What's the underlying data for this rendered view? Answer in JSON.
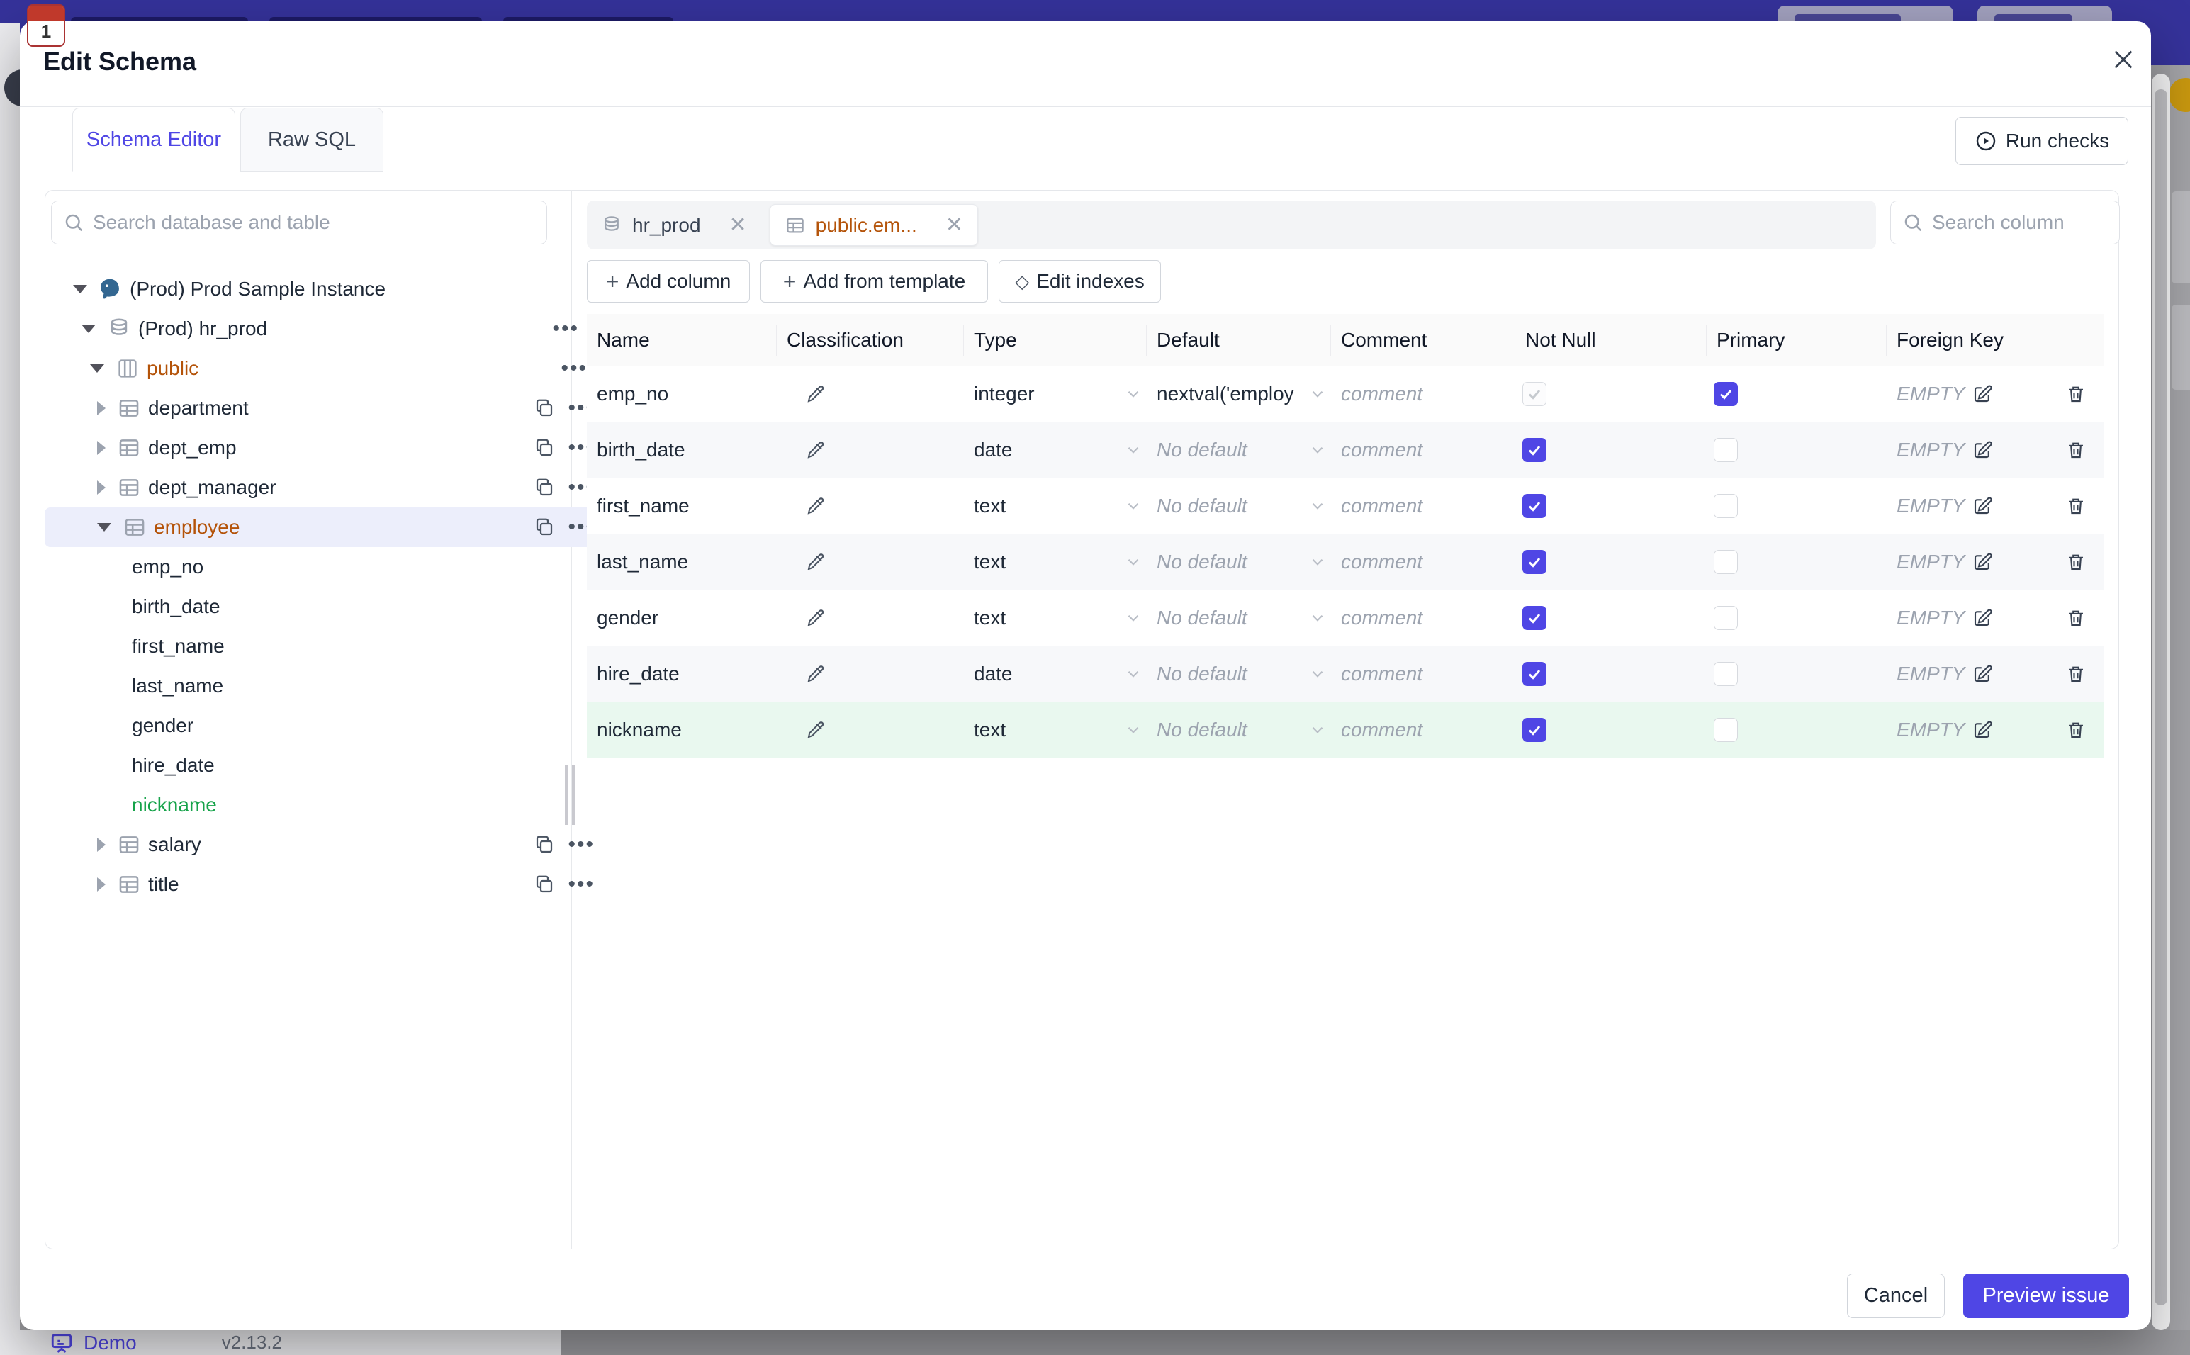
{
  "underlying": {
    "demo_label": "Demo",
    "version": "v2.13.2"
  },
  "modal": {
    "title": "Edit Schema",
    "close_icon": "x",
    "tabs": [
      {
        "label": "Schema Editor",
        "active": true
      },
      {
        "label": "Raw SQL",
        "active": false
      }
    ],
    "run_checks_label": "Run checks",
    "sidebar": {
      "search_placeholder": "Search database and table",
      "tree": [
        {
          "label": "(Prod) Prod Sample Instance",
          "type": "instance",
          "icon": "postgres-icon",
          "expanded": true
        },
        {
          "label": "(Prod) hr_prod",
          "type": "database",
          "icon": "database-icon",
          "expanded": true
        },
        {
          "label": "public",
          "type": "schema",
          "icon": "schema-icon",
          "expanded": true,
          "color": "orange"
        },
        {
          "label": "department",
          "type": "table",
          "icon": "table-icon",
          "expanded": false
        },
        {
          "label": "dept_emp",
          "type": "table",
          "icon": "table-icon",
          "expanded": false
        },
        {
          "label": "dept_manager",
          "type": "table",
          "icon": "table-icon",
          "expanded": false
        },
        {
          "label": "employee",
          "type": "table",
          "icon": "table-icon",
          "expanded": true,
          "selected": true,
          "color": "orange"
        },
        {
          "label": "emp_no",
          "type": "column"
        },
        {
          "label": "birth_date",
          "type": "column"
        },
        {
          "label": "first_name",
          "type": "column"
        },
        {
          "label": "last_name",
          "type": "column"
        },
        {
          "label": "gender",
          "type": "column"
        },
        {
          "label": "hire_date",
          "type": "column"
        },
        {
          "label": "nickname",
          "type": "column",
          "color": "green"
        },
        {
          "label": "salary",
          "type": "table",
          "icon": "table-icon",
          "expanded": false
        },
        {
          "label": "title",
          "type": "table",
          "icon": "table-icon",
          "expanded": false
        }
      ]
    },
    "editor": {
      "chips": [
        {
          "label": "hr_prod",
          "icon": "database-icon",
          "active": false
        },
        {
          "label": "public.em...",
          "icon": "table-icon",
          "active": true
        }
      ],
      "toolbar": {
        "add_column": "Add column",
        "add_from_template": "Add from template",
        "edit_indexes": "Edit indexes"
      },
      "search_placeholder": "Search column",
      "table": {
        "columns": [
          "Name",
          "Classification",
          "Type",
          "Default",
          "Comment",
          "Not Null",
          "Primary",
          "Foreign Key"
        ],
        "comment_placeholder": "comment",
        "rows": [
          {
            "name": "emp_no",
            "type": "integer",
            "default": "nextval('employ",
            "default_is_placeholder": false,
            "comment": "comment",
            "not_null": true,
            "not_null_disabled": true,
            "primary": true,
            "foreign_key": "EMPTY"
          },
          {
            "name": "birth_date",
            "type": "date",
            "default": "No default",
            "default_is_placeholder": true,
            "comment": "comment",
            "not_null": true,
            "not_null_disabled": false,
            "primary": false,
            "foreign_key": "EMPTY"
          },
          {
            "name": "first_name",
            "type": "text",
            "default": "No default",
            "default_is_placeholder": true,
            "comment": "comment",
            "not_null": true,
            "not_null_disabled": false,
            "primary": false,
            "foreign_key": "EMPTY"
          },
          {
            "name": "last_name",
            "type": "text",
            "default": "No default",
            "default_is_placeholder": true,
            "comment": "comment",
            "not_null": true,
            "not_null_disabled": false,
            "primary": false,
            "foreign_key": "EMPTY"
          },
          {
            "name": "gender",
            "type": "text",
            "default": "No default",
            "default_is_placeholder": true,
            "comment": "comment",
            "not_null": true,
            "not_null_disabled": false,
            "primary": false,
            "foreign_key": "EMPTY"
          },
          {
            "name": "hire_date",
            "type": "date",
            "default": "No default",
            "default_is_placeholder": true,
            "comment": "comment",
            "not_null": true,
            "not_null_disabled": false,
            "primary": false,
            "foreign_key": "EMPTY"
          },
          {
            "name": "nickname",
            "type": "text",
            "default": "No default",
            "default_is_placeholder": true,
            "comment": "comment",
            "not_null": true,
            "not_null_disabled": false,
            "primary": false,
            "foreign_key": "EMPTY",
            "new": true
          }
        ]
      }
    },
    "footer": {
      "cancel": "Cancel",
      "primary": "Preview issue"
    }
  },
  "colors": {
    "accent": "#4f46e5",
    "modified_orange": "#b45309",
    "added_green": "#16a34a",
    "new_row_bg": "#e9f8ef"
  }
}
